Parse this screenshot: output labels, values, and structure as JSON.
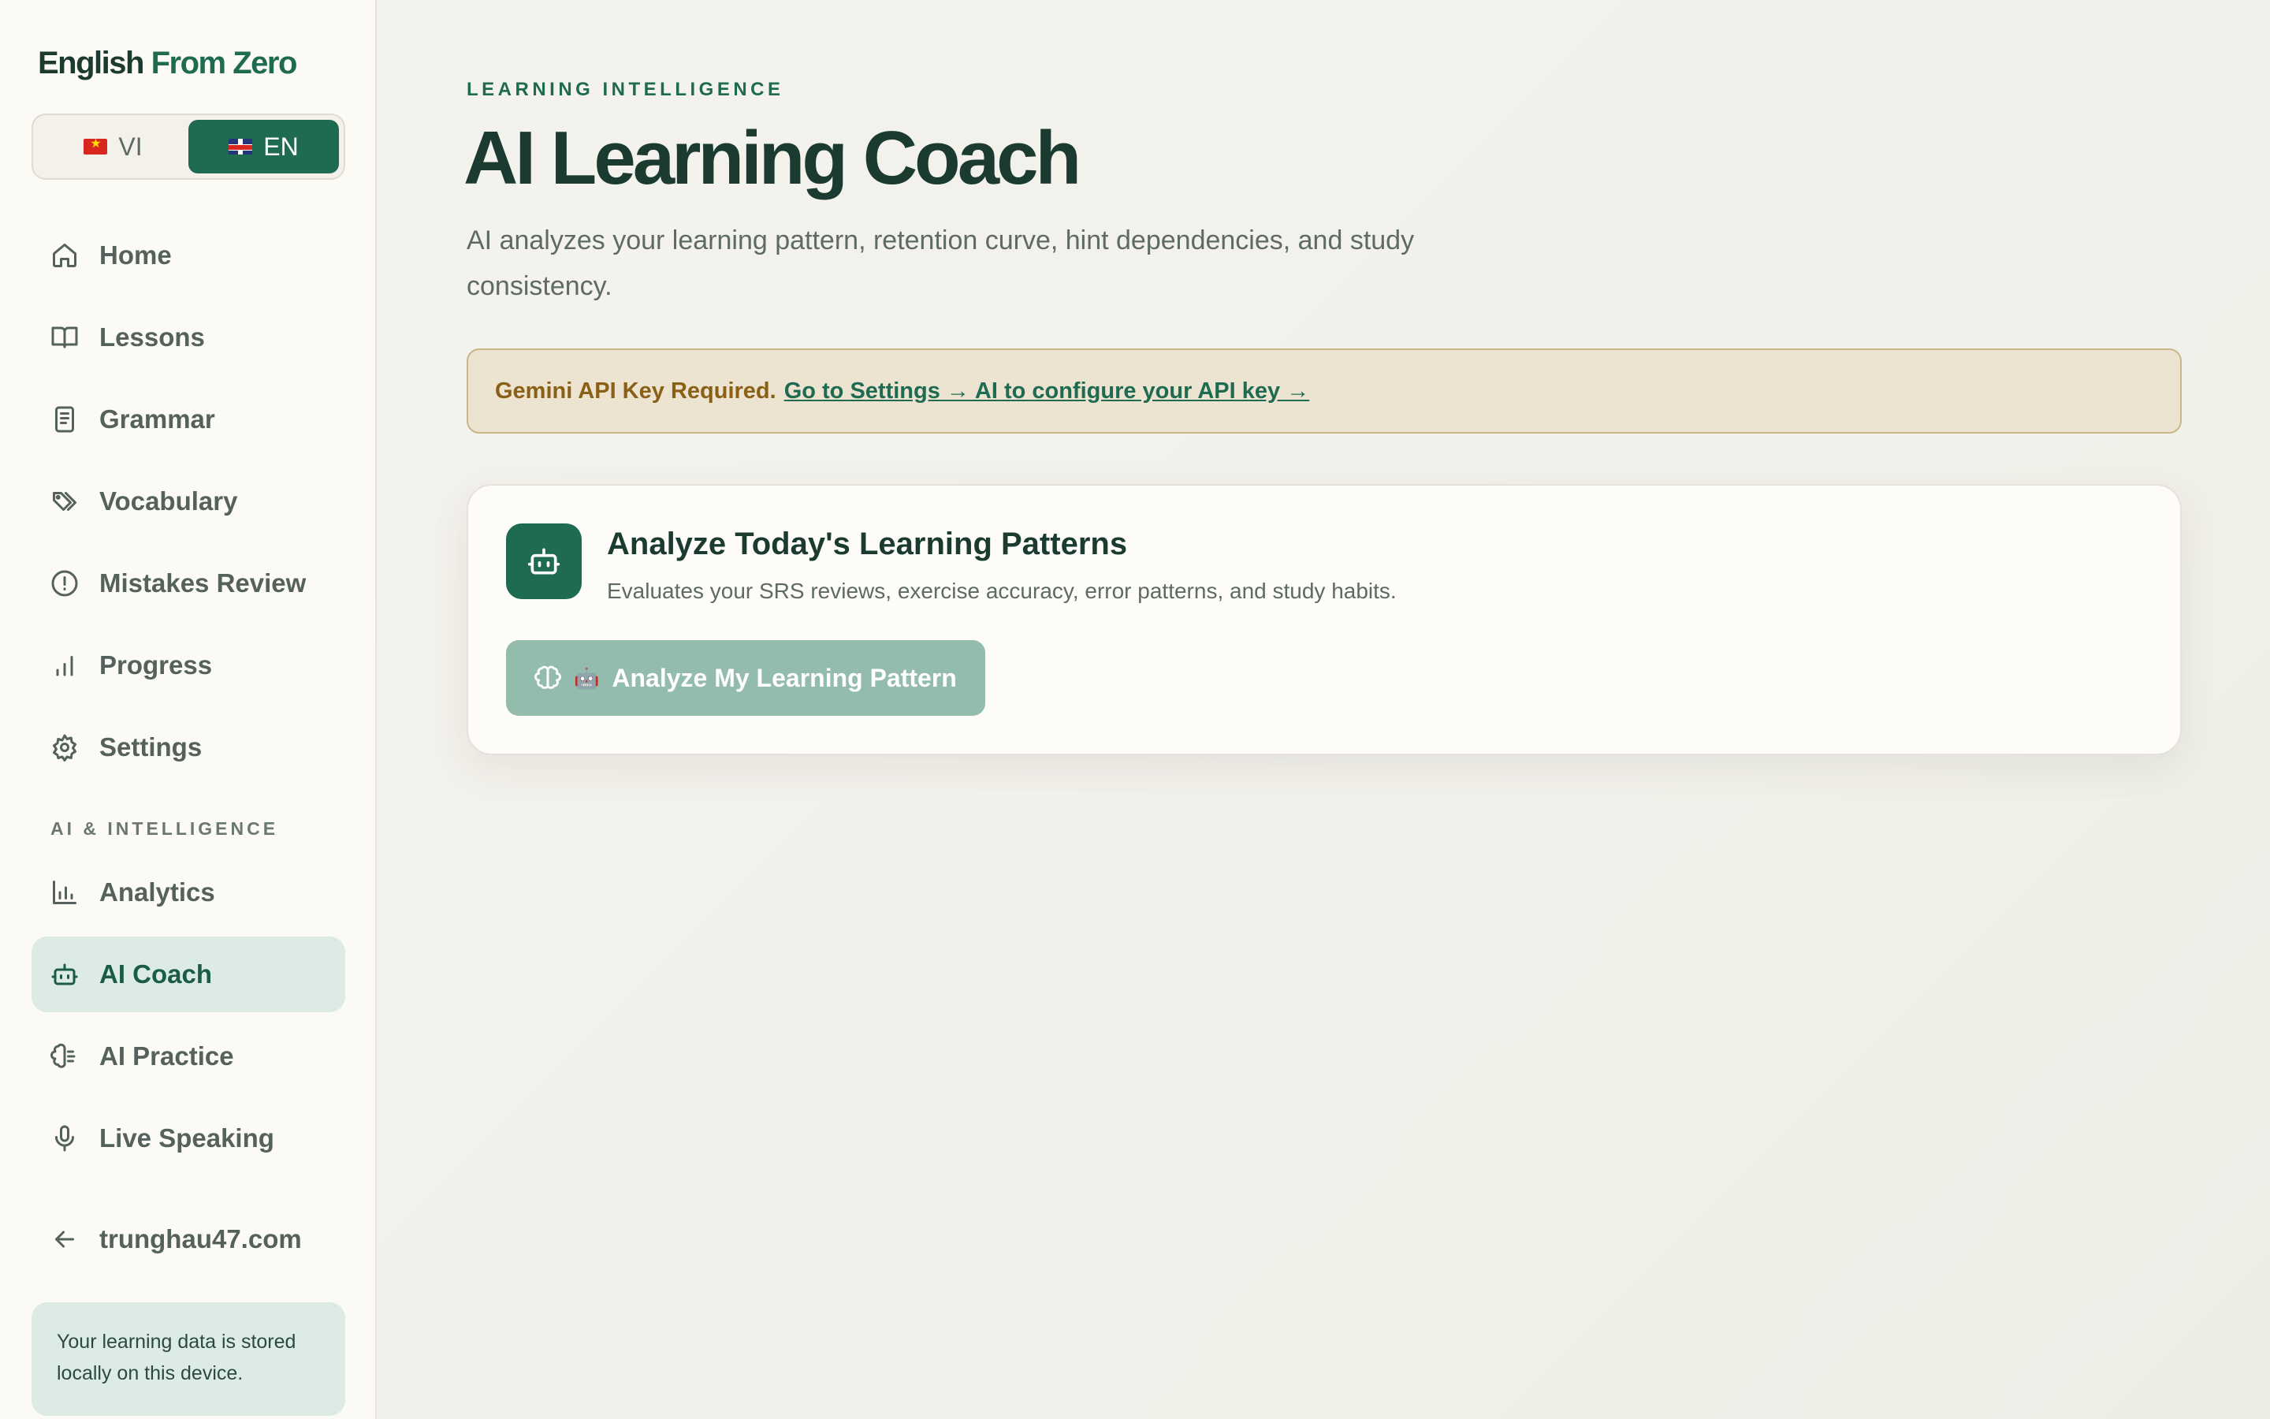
{
  "brand": {
    "name_part1": "English",
    "name_part2": "From Zero"
  },
  "language_toggle": {
    "options": [
      {
        "code": "VI",
        "flag": "flag-vn-icon",
        "selected": false
      },
      {
        "code": "EN",
        "flag": "flag-uk-icon",
        "selected": true
      }
    ]
  },
  "sidebar": {
    "items": [
      {
        "label": "Home",
        "icon": "home-icon"
      },
      {
        "label": "Lessons",
        "icon": "book-open-icon"
      },
      {
        "label": "Grammar",
        "icon": "notebook-icon"
      },
      {
        "label": "Vocabulary",
        "icon": "tags-icon"
      },
      {
        "label": "Mistakes Review",
        "icon": "alert-circle-icon"
      },
      {
        "label": "Progress",
        "icon": "bar-chart-icon"
      },
      {
        "label": "Settings",
        "icon": "gear-icon"
      }
    ],
    "section_label": "AI & INTELLIGENCE",
    "ai_items": [
      {
        "label": "Analytics",
        "icon": "analytics-chart-icon"
      },
      {
        "label": "AI Coach",
        "icon": "bot-icon",
        "active": true
      },
      {
        "label": "AI Practice",
        "icon": "brain-icon"
      },
      {
        "label": "Live Speaking",
        "icon": "microphone-icon"
      }
    ],
    "back_link": {
      "label": "trunghau47.com",
      "icon": "arrow-left-icon"
    },
    "info": "Your learning data is stored locally on this device."
  },
  "main": {
    "eyebrow": "LEARNING INTELLIGENCE",
    "title": "AI Learning Coach",
    "subtitle": "AI analyzes your learning pattern, retention curve, hint dependencies, and study consistency.",
    "alert": {
      "strong": "Gemini API Key Required.",
      "link": "Go to Settings → AI to configure your API key →"
    },
    "card": {
      "title": "Analyze Today's Learning Patterns",
      "description": "Evaluates your SRS reviews, exercise accuracy, error patterns, and study habits.",
      "button_label": "Analyze My Learning Pattern"
    }
  },
  "colors": {
    "accent": "#1f6b52",
    "active_bg": "#dcebe3",
    "alert_bg": "#ece3d1",
    "alert_text": "#8a6016",
    "button_disabled": "#94bcac"
  }
}
